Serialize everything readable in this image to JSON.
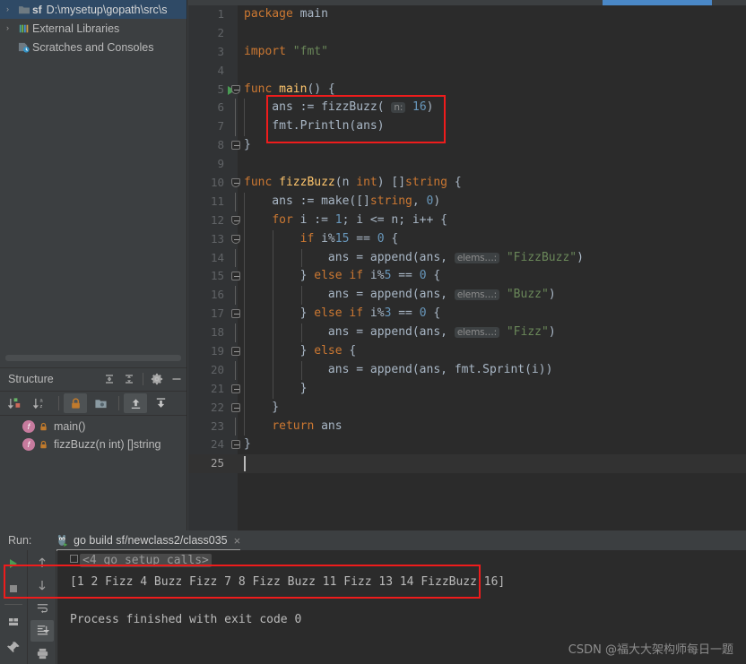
{
  "sidebar": {
    "tree": [
      {
        "label": "D:\\mysetup\\gopath\\src\\s",
        "prefix": "sf",
        "icon": "folder-icon",
        "arrow": "›",
        "selected": true
      },
      {
        "label": "External Libraries",
        "prefix": "",
        "icon": "library-icon",
        "arrow": "›",
        "selected": false
      },
      {
        "label": "Scratches and Consoles",
        "prefix": "",
        "icon": "scratches-icon",
        "arrow": "",
        "selected": false
      }
    ]
  },
  "structure": {
    "title": "Structure",
    "header_buttons": [
      {
        "name": "expand-all-icon",
        "label": "Expand All"
      },
      {
        "name": "collapse-all-icon",
        "label": "Collapse All"
      },
      {
        "name": "gear-icon",
        "label": "Settings"
      },
      {
        "name": "minimize-icon",
        "label": "Hide"
      }
    ],
    "toolbar_buttons": [
      {
        "name": "sort-by-visibility-icon",
        "active": false
      },
      {
        "name": "sort-alphabetically-icon",
        "active": false
      },
      {
        "name": "show-non-public-icon",
        "active": true
      },
      {
        "name": "show-fields-icon",
        "active": false
      },
      {
        "name": "show-inherited-icon",
        "active": true
      },
      {
        "name": "show-imported-icon",
        "active": false
      }
    ],
    "items": [
      {
        "badge": "f",
        "label": "main()"
      },
      {
        "badge": "f",
        "label": "fizzBuzz(n int) []string"
      }
    ]
  },
  "editor": {
    "lines": [
      {
        "n": "1",
        "indent": 0,
        "tokens": [
          {
            "t": "package ",
            "c": "kw"
          },
          {
            "t": "main",
            "c": "plain"
          }
        ]
      },
      {
        "n": "2",
        "indent": 0,
        "tokens": []
      },
      {
        "n": "3",
        "indent": 0,
        "tokens": [
          {
            "t": "import ",
            "c": "kw"
          },
          {
            "t": "\"fmt\"",
            "c": "str"
          }
        ]
      },
      {
        "n": "4",
        "indent": 0,
        "tokens": []
      },
      {
        "n": "5",
        "indent": 0,
        "run": true,
        "fold": "open",
        "tokens": [
          {
            "t": "func ",
            "c": "kw"
          },
          {
            "t": "main",
            "c": "fn"
          },
          {
            "t": "() {",
            "c": "plain"
          }
        ]
      },
      {
        "n": "6",
        "indent": 0,
        "guide": 1,
        "tokens": [
          {
            "t": "    ans := ",
            "c": "plain"
          },
          {
            "t": "fizzBuzz",
            "c": "plain"
          },
          {
            "t": "( ",
            "c": "plain"
          },
          {
            "t": "n:",
            "c": "hint"
          },
          {
            "t": " ",
            "c": "plain"
          },
          {
            "t": "16",
            "c": "num"
          },
          {
            "t": ")",
            "c": "plain"
          }
        ]
      },
      {
        "n": "7",
        "indent": 0,
        "guide": 1,
        "tokens": [
          {
            "t": "    fmt",
            "c": "plain"
          },
          {
            "t": ".",
            "c": "plain"
          },
          {
            "t": "Println",
            "c": "plain"
          },
          {
            "t": "(ans)",
            "c": "plain"
          }
        ]
      },
      {
        "n": "8",
        "indent": 0,
        "fold": "close",
        "tokens": [
          {
            "t": "}",
            "c": "plain"
          }
        ]
      },
      {
        "n": "9",
        "indent": 0,
        "tokens": []
      },
      {
        "n": "10",
        "indent": 0,
        "fold": "open",
        "tokens": [
          {
            "t": "func ",
            "c": "kw"
          },
          {
            "t": "fizzBuzz",
            "c": "fn"
          },
          {
            "t": "(n ",
            "c": "plain"
          },
          {
            "t": "int",
            "c": "kw"
          },
          {
            "t": ") []",
            "c": "plain"
          },
          {
            "t": "string",
            "c": "kw"
          },
          {
            "t": " {",
            "c": "plain"
          }
        ]
      },
      {
        "n": "11",
        "indent": 0,
        "guide": 1,
        "tokens": [
          {
            "t": "    ans := ",
            "c": "plain"
          },
          {
            "t": "make",
            "c": "plain"
          },
          {
            "t": "([]",
            "c": "plain"
          },
          {
            "t": "string",
            "c": "kw"
          },
          {
            "t": ", ",
            "c": "plain"
          },
          {
            "t": "0",
            "c": "num"
          },
          {
            "t": ")",
            "c": "plain"
          }
        ]
      },
      {
        "n": "12",
        "indent": 0,
        "guide": 1,
        "fold": "open",
        "tokens": [
          {
            "t": "    ",
            "c": "plain"
          },
          {
            "t": "for ",
            "c": "kw"
          },
          {
            "t": "i := ",
            "c": "plain"
          },
          {
            "t": "1",
            "c": "num"
          },
          {
            "t": "; i <= n; i++ {",
            "c": "plain"
          }
        ]
      },
      {
        "n": "13",
        "indent": 0,
        "guide": 2,
        "fold": "open",
        "tokens": [
          {
            "t": "        ",
            "c": "plain"
          },
          {
            "t": "if ",
            "c": "kw"
          },
          {
            "t": "i%",
            "c": "plain"
          },
          {
            "t": "15",
            "c": "num"
          },
          {
            "t": " == ",
            "c": "plain"
          },
          {
            "t": "0",
            "c": "num"
          },
          {
            "t": " {",
            "c": "plain"
          }
        ]
      },
      {
        "n": "14",
        "indent": 0,
        "guide": 3,
        "tokens": [
          {
            "t": "            ans = ",
            "c": "plain"
          },
          {
            "t": "append",
            "c": "plain"
          },
          {
            "t": "(ans, ",
            "c": "plain"
          },
          {
            "t": "elems…:",
            "c": "hint"
          },
          {
            "t": " ",
            "c": "plain"
          },
          {
            "t": "\"FizzBuzz\"",
            "c": "str"
          },
          {
            "t": ")",
            "c": "plain"
          }
        ]
      },
      {
        "n": "15",
        "indent": 0,
        "guide": 2,
        "fold": "close",
        "tokens": [
          {
            "t": "        } ",
            "c": "plain"
          },
          {
            "t": "else if ",
            "c": "kw"
          },
          {
            "t": "i%",
            "c": "plain"
          },
          {
            "t": "5",
            "c": "num"
          },
          {
            "t": " == ",
            "c": "plain"
          },
          {
            "t": "0",
            "c": "num"
          },
          {
            "t": " {",
            "c": "plain"
          }
        ]
      },
      {
        "n": "16",
        "indent": 0,
        "guide": 3,
        "tokens": [
          {
            "t": "            ans = ",
            "c": "plain"
          },
          {
            "t": "append",
            "c": "plain"
          },
          {
            "t": "(ans, ",
            "c": "plain"
          },
          {
            "t": "elems…:",
            "c": "hint"
          },
          {
            "t": " ",
            "c": "plain"
          },
          {
            "t": "\"Buzz\"",
            "c": "str"
          },
          {
            "t": ")",
            "c": "plain"
          }
        ]
      },
      {
        "n": "17",
        "indent": 0,
        "guide": 2,
        "fold": "close",
        "tokens": [
          {
            "t": "        } ",
            "c": "plain"
          },
          {
            "t": "else if ",
            "c": "kw"
          },
          {
            "t": "i%",
            "c": "plain"
          },
          {
            "t": "3",
            "c": "num"
          },
          {
            "t": " == ",
            "c": "plain"
          },
          {
            "t": "0",
            "c": "num"
          },
          {
            "t": " {",
            "c": "plain"
          }
        ]
      },
      {
        "n": "18",
        "indent": 0,
        "guide": 3,
        "tokens": [
          {
            "t": "            ans = ",
            "c": "plain"
          },
          {
            "t": "append",
            "c": "plain"
          },
          {
            "t": "(ans, ",
            "c": "plain"
          },
          {
            "t": "elems…:",
            "c": "hint"
          },
          {
            "t": " ",
            "c": "plain"
          },
          {
            "t": "\"Fizz\"",
            "c": "str"
          },
          {
            "t": ")",
            "c": "plain"
          }
        ]
      },
      {
        "n": "19",
        "indent": 0,
        "guide": 2,
        "fold": "close",
        "tokens": [
          {
            "t": "        } ",
            "c": "plain"
          },
          {
            "t": "else ",
            "c": "kw"
          },
          {
            "t": "{",
            "c": "plain"
          }
        ]
      },
      {
        "n": "20",
        "indent": 0,
        "guide": 3,
        "tokens": [
          {
            "t": "            ans = ",
            "c": "plain"
          },
          {
            "t": "append",
            "c": "plain"
          },
          {
            "t": "(ans, fmt.",
            "c": "plain"
          },
          {
            "t": "Sprint",
            "c": "plain"
          },
          {
            "t": "(i))",
            "c": "plain"
          }
        ]
      },
      {
        "n": "21",
        "indent": 0,
        "guide": 2,
        "fold": "close",
        "tokens": [
          {
            "t": "        }",
            "c": "plain"
          }
        ]
      },
      {
        "n": "22",
        "indent": 0,
        "guide": 1,
        "fold": "close",
        "tokens": [
          {
            "t": "    }",
            "c": "plain"
          }
        ]
      },
      {
        "n": "23",
        "indent": 0,
        "guide": 1,
        "tokens": [
          {
            "t": "    ",
            "c": "plain"
          },
          {
            "t": "return ",
            "c": "kw"
          },
          {
            "t": "ans",
            "c": "plain"
          }
        ]
      },
      {
        "n": "24",
        "indent": 0,
        "fold": "close",
        "tokens": [
          {
            "t": "}",
            "c": "plain"
          }
        ]
      },
      {
        "n": "25",
        "indent": 0,
        "current": true,
        "caret": true,
        "tokens": []
      }
    ]
  },
  "run": {
    "label": "Run:",
    "tab_title": "go build sf/newclass2/class035",
    "tab_close": "×",
    "side_buttons": [
      {
        "name": "rerun-button",
        "active": false
      },
      {
        "name": "stop-button",
        "active": false
      },
      {
        "name": "restore-layout-button",
        "active": false
      },
      {
        "name": "pin-tab-button",
        "active": false
      }
    ],
    "side_buttons2": [
      {
        "name": "scroll-up-button",
        "active": false
      },
      {
        "name": "scroll-down-button",
        "active": false
      },
      {
        "name": "soft-wrap-button",
        "active": false
      },
      {
        "name": "scroll-to-end-button",
        "active": true
      },
      {
        "name": "print-button",
        "active": false
      }
    ],
    "console": {
      "fold_line": "<4 go setup calls>",
      "output_line": "[1 2 Fizz 4 Buzz Fizz 7 8 Fizz Buzz 11 Fizz 13 14 FizzBuzz 16]",
      "exit_line": "Process finished with exit code 0"
    }
  },
  "annotations": {
    "box_color": "#ee1c1c",
    "code_box_name": "code-highlight-box",
    "console_box_name": "output-highlight-box"
  },
  "watermark": "CSDN @福大大架构师每日一题"
}
